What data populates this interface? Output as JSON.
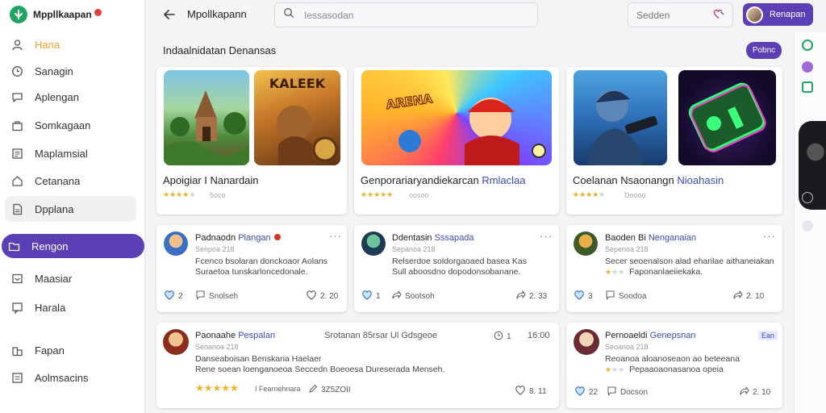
{
  "app": {
    "brand": "Mppllkaapan",
    "title": "Mpollkapann",
    "search_placeholder": "Iessasodan",
    "filter_label": "Sedden",
    "user_label": "Renapan",
    "colors": {
      "accent": "#5b3fb4",
      "brand_green": "#1fa463",
      "star": "#f2b01e",
      "home_label": "#f0a12a"
    }
  },
  "sidebar": {
    "items": [
      {
        "label": "Hana",
        "icon": "user-icon"
      },
      {
        "label": "Sanagin",
        "icon": "clock-icon"
      },
      {
        "label": "Aplengan",
        "icon": "chat-icon"
      },
      {
        "label": "Somkagaan",
        "icon": "bag-icon"
      },
      {
        "label": "Maplamsial",
        "icon": "news-icon"
      },
      {
        "label": "Cetanana",
        "icon": "house-icon"
      },
      {
        "label": "Dpplana",
        "icon": "document-icon"
      },
      {
        "label": "Rengon",
        "icon": "folder-icon"
      },
      {
        "label": "Maasiar",
        "icon": "inbox-icon"
      },
      {
        "label": "Harala",
        "icon": "flag-icon"
      },
      {
        "label": "Fapan",
        "icon": "building-icon"
      },
      {
        "label": "Aolmsacins",
        "icon": "list-icon"
      }
    ]
  },
  "section": {
    "title": "Indaalnidatan Denansas",
    "more_label": "Pobnc"
  },
  "games": [
    {
      "title": "Apoigiar I Nanardain",
      "highlight": "",
      "stars": 4,
      "rating": "5oco"
    },
    {
      "title": "Genporariaryandiekarcan ",
      "highlight": "Rmlaclaa",
      "stars": 5,
      "rating": "oosoo"
    },
    {
      "title": "Coelanan Nsaonangn ",
      "highlight": "Nioahasin",
      "stars": 4,
      "rating": "Doooo"
    }
  ],
  "game_art": [
    "fortress",
    "kaleak",
    "arena",
    "soldier",
    "neon"
  ],
  "game_art_caption": "KALEEK",
  "posts": [
    {
      "name": "Padnaodn ",
      "tag": "Plangan",
      "flag": true,
      "meta": "Senpoa 218",
      "lines": [
        "Fcenco bsolaran donckoaor Aolans",
        "Suraetoa tunskarloncedonale."
      ],
      "like": "2",
      "comment": "Snolseh",
      "share": "2. 20"
    },
    {
      "name": "Ddentasin ",
      "tag": "Sssapada",
      "flag": false,
      "meta": "Sepanoa 218",
      "lines": [
        "Relserdoe soldorgaoaed basea Kas",
        "Sull aboosdno dopodonsobanane."
      ],
      "like": "1",
      "comment": "Sootsoh",
      "share": "2. 33"
    },
    {
      "name": "Baoden Bi ",
      "tag": "Nenganaian",
      "flag": false,
      "meta": "Sepenoa 218",
      "lines": [
        "Secer seoenalson alad eharilae aithaneiakan",
        "Faponanlaeiiekaka."
      ],
      "stars": 1,
      "like": "3",
      "comment": "Soodoa",
      "share": "2. 10"
    },
    {
      "name": "Paonaahe ",
      "tag": "Pespalan",
      "flag": false,
      "meta": "Seoanoa 218",
      "lines": [
        "Danseaboisan Benskaria Haelaer",
        "Rene soean loenganoeoa Seccedn Boeoesa Dureserada Menseh."
      ],
      "extra_title": "Srotanan 85rsar Ul Gdsgeoe",
      "extra_count": "1",
      "extra_time": "16:00",
      "stars": 5,
      "rating_text": "I Fearnehnara",
      "rating_num": "3Z5ZOII",
      "like": "8. 11"
    },
    {
      "name": "Pernoaeldi ",
      "tag": "Genepsnan",
      "flag": false,
      "meta": "Seoanoa 218",
      "lines": [
        "Reoanoa aloanoseaon ao beteeana",
        "Pepaaoaonasanoa opeia"
      ],
      "badge": "Ean",
      "stars": 1,
      "like": "22",
      "comment": "Docson",
      "share": "2. 10"
    }
  ]
}
